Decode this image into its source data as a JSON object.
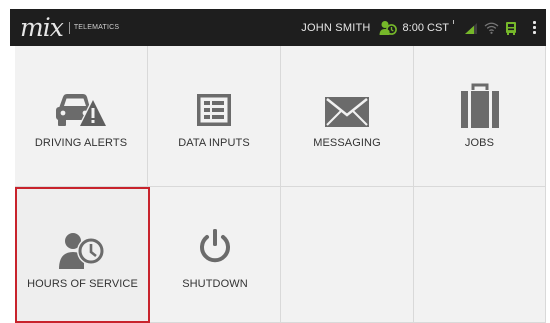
{
  "header": {
    "logo_mark": "mix",
    "logo_text": "TELEMATICS",
    "user_name": "JOHN SMITH",
    "time": "8:00 CST",
    "icons": [
      "driver-status-icon",
      "signal-icon",
      "wifi-icon",
      "device-icon",
      "overflow-menu-icon"
    ]
  },
  "colors": {
    "topbar": "#1e1e1e",
    "tile_bg": "#f2f2f2",
    "icon_gray": "#6b6b6b",
    "accent_green": "#76b82a",
    "selected_border": "#c8232c"
  },
  "tiles": [
    {
      "label": "DRIVING ALERTS",
      "icon": "driving-alert-icon"
    },
    {
      "label": "DATA INPUTS",
      "icon": "data-inputs-icon"
    },
    {
      "label": "MESSAGING",
      "icon": "envelope-icon"
    },
    {
      "label": "JOBS",
      "icon": "briefcase-icon"
    },
    {
      "label": "HOURS OF SERVICE",
      "icon": "hours-of-service-icon",
      "selected": true
    },
    {
      "label": "SHUTDOWN",
      "icon": "power-icon"
    },
    {
      "label": "",
      "icon": ""
    },
    {
      "label": "",
      "icon": ""
    }
  ]
}
